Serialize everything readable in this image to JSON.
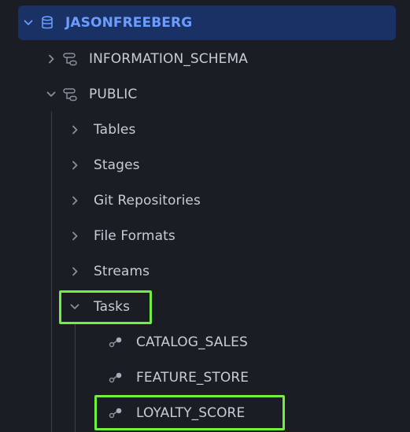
{
  "tree": {
    "database": {
      "name": "JASONFREEBERG",
      "icon": "database-icon",
      "expanded": true
    },
    "schemas": [
      {
        "name": "INFORMATION_SCHEMA",
        "icon": "schema-icon",
        "expanded": false
      },
      {
        "name": "PUBLIC",
        "icon": "schema-icon",
        "expanded": true
      }
    ],
    "public_children": [
      {
        "label": "Tables",
        "expanded": false
      },
      {
        "label": "Stages",
        "expanded": false
      },
      {
        "label": "Git Repositories",
        "expanded": false
      },
      {
        "label": "File Formats",
        "expanded": false
      },
      {
        "label": "Streams",
        "expanded": false
      },
      {
        "label": "Tasks",
        "expanded": true
      }
    ],
    "tasks": [
      {
        "name": "CATALOG_SALES",
        "icon": "task-icon"
      },
      {
        "name": "FEATURE_STORE",
        "icon": "task-icon"
      },
      {
        "name": "LOYALTY_SCORE",
        "icon": "task-icon"
      }
    ]
  },
  "colors": {
    "background": "#1a1d24",
    "selected_row": "#1a3166",
    "selected_text": "#6b9cff",
    "text": "#c9ccd4",
    "highlight_box": "#6ef03c"
  }
}
